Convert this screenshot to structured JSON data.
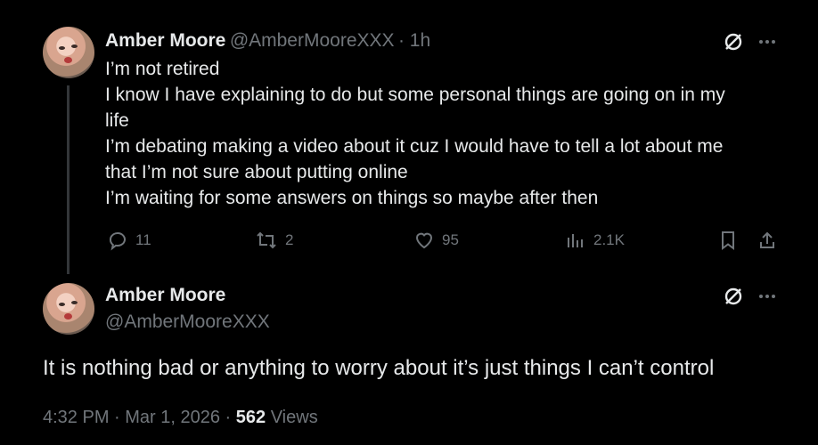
{
  "tweet1": {
    "author_name": "Amber Moore",
    "author_handle": "@AmberMooreXXX",
    "time": "· 1h",
    "lines": [
      "I’m not retired",
      "I know I have explaining to do but some personal things are going on in my",
      "life",
      "I’m debating making a video about it cuz I would have to tell a lot about me",
      "that I’m not sure about putting online",
      "I’m waiting for some answers on things so maybe after then"
    ],
    "actions": {
      "replies": "11",
      "reposts": "2",
      "likes": "95",
      "views": "2.1K"
    }
  },
  "tweet2": {
    "author_name": "Amber Moore",
    "author_handle": "@AmberMooreXXX",
    "text": "It is nothing bad or anything to worry about it’s just things I can’t control",
    "timestamp": "4:32 PM · Mar 1, 2026 ·",
    "views_count": "562",
    "views_label": "Views"
  },
  "colors": {
    "background": "#000000",
    "text": "#e7e9ea",
    "muted": "#71767b"
  },
  "icons": [
    "grok-icon",
    "more-icon",
    "reply-icon",
    "repost-icon",
    "like-icon",
    "views-icon",
    "bookmark-icon",
    "share-icon"
  ]
}
